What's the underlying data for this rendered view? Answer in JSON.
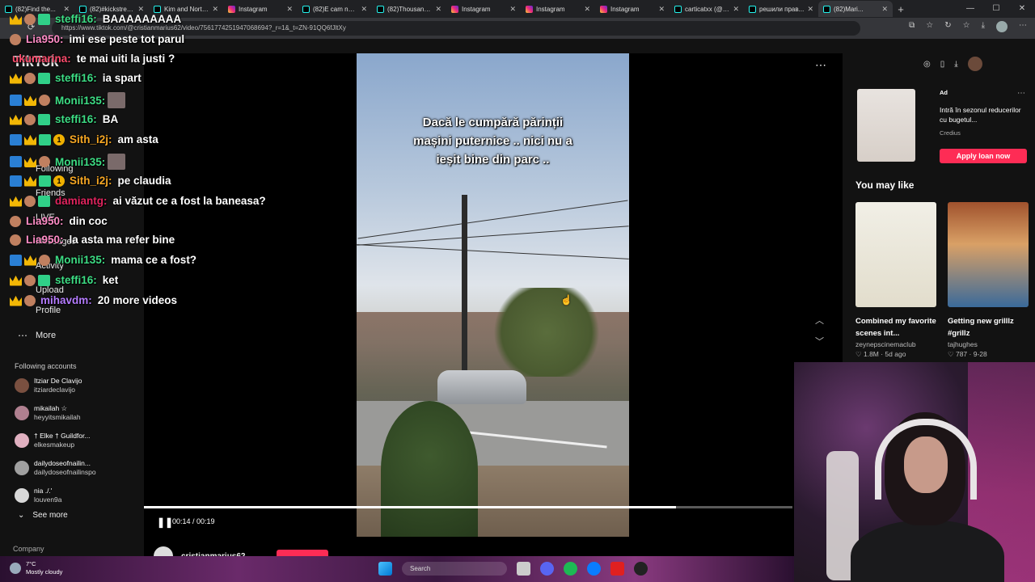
{
  "browser": {
    "tabs": [
      {
        "label": "(82)Find the...",
        "favicon": "tiktok"
      },
      {
        "label": "(82)#kickstrea...",
        "favicon": "tiktok"
      },
      {
        "label": "Kim and North...",
        "favicon": "tiktok"
      },
      {
        "label": "Instagram",
        "favicon": "instagram"
      },
      {
        "label": "(82)E cam neb...",
        "favicon": "tiktok"
      },
      {
        "label": "(82)Thousands...",
        "favicon": "tiktok"
      },
      {
        "label": "Instagram",
        "favicon": "instagram"
      },
      {
        "label": "Instagram",
        "favicon": "instagram"
      },
      {
        "label": "Instagram",
        "favicon": "instagram"
      },
      {
        "label": "carticatxx (@c...",
        "favicon": "tiktok"
      },
      {
        "label": "решили прав...",
        "favicon": "tiktok"
      },
      {
        "label": "(82)Mari...",
        "favicon": "tiktok",
        "active": true
      }
    ],
    "url": "https://www.tiktok.com/@cristianmarius62/video/7561774251947068694?_r=1&_t=ZN-91QQ6fJltXy"
  },
  "tiktok": {
    "logo": "TikTok",
    "nav": [
      {
        "label": "Following",
        "icon": "users-icon"
      },
      {
        "label": "Friends",
        "icon": "friends-icon"
      },
      {
        "label": "LIVE",
        "icon": "live-icon"
      },
      {
        "label": "Messages",
        "icon": "messages-icon"
      },
      {
        "label": "Activity",
        "icon": "activity-icon"
      },
      {
        "label": "Upload",
        "icon": "upload-icon"
      },
      {
        "label": "Profile",
        "icon": "profile-icon"
      },
      {
        "label": "More",
        "icon": "more-icon"
      }
    ],
    "following_title": "Following accounts",
    "following": [
      {
        "name": "Itziar De Clavijo",
        "handle": "itziardeclavijo"
      },
      {
        "name": "mikailah ☆",
        "handle": "heyyitsmikailah"
      },
      {
        "name": "† Elke † Guildfor...",
        "handle": "elkesmakeup"
      },
      {
        "name": "dailydoseofnailin...",
        "handle": "dailydoseofnailinspo"
      },
      {
        "name": "nia ./.'",
        "handle": "louven9a"
      }
    ],
    "see_more": "See more",
    "company": "Company",
    "video": {
      "caption": "Dacă le cumpără părinții\nmașini puternice .. nici nu a\nieșit bine din parc ..",
      "time": "00:14 / 00:19",
      "progress": 0.82,
      "author": "cristianmarius62"
    },
    "ad": {
      "label": "Ad",
      "text": "Intră în sezonul reducerilor cu bugetul...",
      "brand": "Credius",
      "button": "Apply loan now"
    },
    "you_may_like": "You may like",
    "cards": [
      {
        "title": "Combined my favorite scenes int...",
        "user": "zeynepscinemaclub",
        "stats": "♡ 1.8M · 5d ago"
      },
      {
        "title": "Getting new grilllz #grillz",
        "user": "tajhughes",
        "stats": "♡ 787 · 9-28"
      }
    ]
  },
  "chat": [
    {
      "user": "steffi16:",
      "msg": "BAAAAAAAAA",
      "color": "#3ddc84",
      "badges": [
        "crown",
        "emote",
        "gift"
      ]
    },
    {
      "user": "Lia950:",
      "msg": "imi ese peste tot parul",
      "color": "#ff8cc6",
      "badges": [
        "emote"
      ]
    },
    {
      "user": "ukumarina:",
      "msg": "te mai uiti la justi ?",
      "color": "#ff4d6d",
      "badges": []
    },
    {
      "user": "steffi16:",
      "msg": "ia spart",
      "color": "#3ddc84",
      "badges": [
        "crown",
        "emote",
        "gift"
      ]
    },
    {
      "user": "Monii135:",
      "msg": "",
      "color": "#3ddc84",
      "badges": [
        "wrench",
        "crown",
        "emote"
      ],
      "emote": true
    },
    {
      "user": "steffi16:",
      "msg": "BA",
      "color": "#3ddc84",
      "badges": [
        "crown",
        "emote",
        "gift"
      ]
    },
    {
      "user": "Sith_i2j:",
      "msg": "am asta",
      "color": "#f5a623",
      "badges": [
        "wrench",
        "crown",
        "gift",
        "one"
      ]
    },
    {
      "user": "Monii135:",
      "msg": "",
      "color": "#3ddc84",
      "badges": [
        "wrench",
        "crown",
        "emote"
      ],
      "emote": true
    },
    {
      "user": "Sith_i2j:",
      "msg": "pe claudia",
      "color": "#f5a623",
      "badges": [
        "wrench",
        "crown",
        "gift",
        "one"
      ]
    },
    {
      "user": "damiantg:",
      "msg": "ai văzut ce a fost la baneasa?",
      "color": "#e0245e",
      "badges": [
        "crown",
        "emote",
        "gift"
      ]
    },
    {
      "user": "Lia950:",
      "msg": "din coc",
      "color": "#ff8cc6",
      "badges": [
        "emote"
      ]
    },
    {
      "user": "Lia950:",
      "msg": "la asta ma refer bine",
      "color": "#ff8cc6",
      "badges": [
        "emote"
      ]
    },
    {
      "user": "Monii135:",
      "msg": "mama ce a fost?",
      "color": "#3ddc84",
      "badges": [
        "wrench",
        "crown",
        "emote"
      ]
    },
    {
      "user": "steffi16:",
      "msg": "ket",
      "color": "#3ddc84",
      "badges": [
        "crown",
        "emote",
        "gift"
      ]
    },
    {
      "user": "mihavdm:",
      "msg": "20 more videos",
      "color": "#b57cff",
      "badges": [
        "crown",
        "emote"
      ]
    }
  ],
  "taskbar": {
    "temp": "7°C",
    "weather": "Mostly cloudy",
    "search": "Search"
  }
}
